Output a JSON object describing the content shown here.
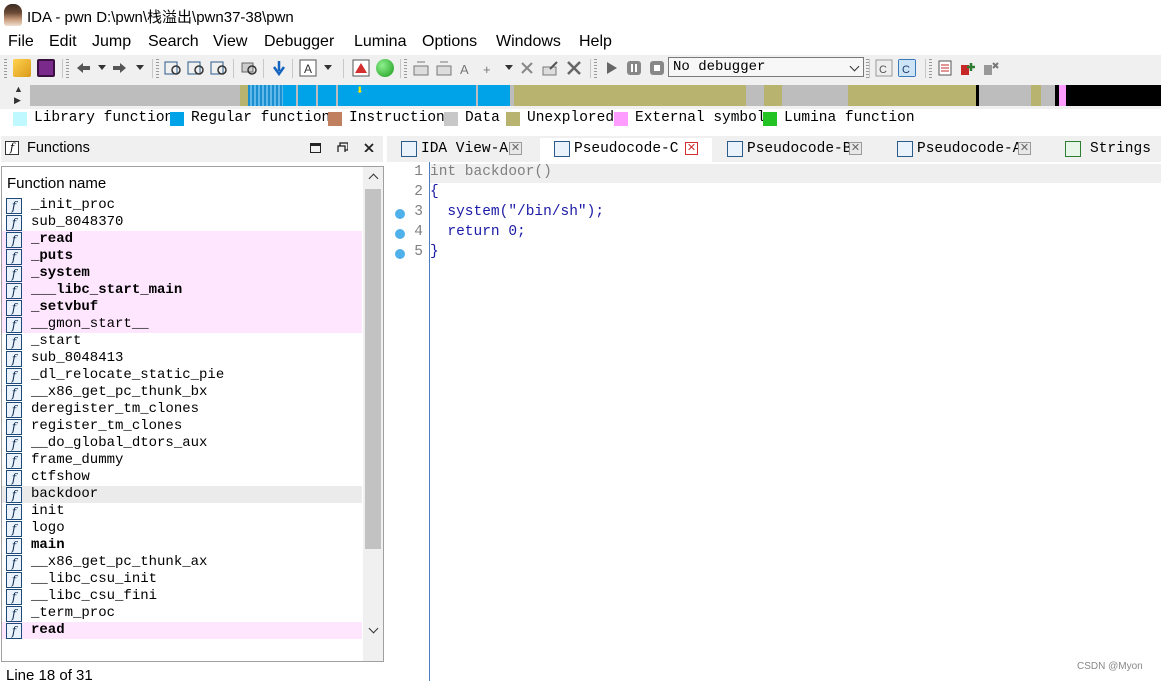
{
  "window": {
    "title": "IDA - pwn D:\\pwn\\栈溢出\\pwn37-38\\pwn"
  },
  "menu": [
    "File",
    "Edit",
    "Jump",
    "Search",
    "View",
    "Debugger",
    "Lumina",
    "Options",
    "Windows",
    "Help"
  ],
  "toolbar": {
    "debugger_select": "No debugger"
  },
  "legend": [
    {
      "label": "Library function",
      "color": "#c0f8ff"
    },
    {
      "label": "Regular function",
      "color": "#00a2e8"
    },
    {
      "label": "Instruction",
      "color": "#c08060"
    },
    {
      "label": "Data",
      "color": "#c8c8c8"
    },
    {
      "label": "Unexplored",
      "color": "#b8b470"
    },
    {
      "label": "External symbol",
      "color": "#ff9cff"
    },
    {
      "label": "Lumina function",
      "color": "#22c322"
    }
  ],
  "functions_panel": {
    "title": "Functions",
    "column_header": "Function name",
    "functions": [
      {
        "name": "_init_proc",
        "kind": "regular"
      },
      {
        "name": "sub_8048370",
        "kind": "regular"
      },
      {
        "name": "_read",
        "kind": "external"
      },
      {
        "name": "_puts",
        "kind": "external"
      },
      {
        "name": "_system",
        "kind": "external"
      },
      {
        "name": "___libc_start_main",
        "kind": "external"
      },
      {
        "name": "_setvbuf",
        "kind": "external"
      },
      {
        "name": "__gmon_start__",
        "kind": "external_light"
      },
      {
        "name": "_start",
        "kind": "regular"
      },
      {
        "name": "sub_8048413",
        "kind": "regular"
      },
      {
        "name": "_dl_relocate_static_pie",
        "kind": "regular"
      },
      {
        "name": "__x86_get_pc_thunk_bx",
        "kind": "regular"
      },
      {
        "name": "deregister_tm_clones",
        "kind": "regular"
      },
      {
        "name": "register_tm_clones",
        "kind": "regular"
      },
      {
        "name": "__do_global_dtors_aux",
        "kind": "regular"
      },
      {
        "name": "frame_dummy",
        "kind": "regular"
      },
      {
        "name": "ctfshow",
        "kind": "regular"
      },
      {
        "name": "backdoor",
        "kind": "selected"
      },
      {
        "name": "init",
        "kind": "regular"
      },
      {
        "name": "logo",
        "kind": "regular"
      },
      {
        "name": "main",
        "kind": "bold"
      },
      {
        "name": "__x86_get_pc_thunk_ax",
        "kind": "regular"
      },
      {
        "name": "__libc_csu_init",
        "kind": "regular"
      },
      {
        "name": "__libc_csu_fini",
        "kind": "regular"
      },
      {
        "name": "_term_proc",
        "kind": "regular"
      },
      {
        "name": "read",
        "kind": "external"
      }
    ],
    "status": "Line 18 of 31"
  },
  "tabs": [
    {
      "label": "IDA View-A",
      "active": false
    },
    {
      "label": "Pseudocode-C",
      "active": true
    },
    {
      "label": "Pseudocode-B",
      "active": false
    },
    {
      "label": "Pseudocode-A",
      "active": false
    },
    {
      "label": "Strings",
      "active": false
    }
  ],
  "code": {
    "lines": [
      {
        "num": "1",
        "text": "int backdoor()",
        "breakpoint": false
      },
      {
        "num": "2",
        "text": "{",
        "breakpoint": false
      },
      {
        "num": "3",
        "text": "  system(\"/bin/sh\");",
        "breakpoint": true
      },
      {
        "num": "4",
        "text": "  return 0;",
        "breakpoint": true
      },
      {
        "num": "5",
        "text": "}",
        "breakpoint": true
      }
    ]
  },
  "watermark": "CSDN @Myon⁠"
}
